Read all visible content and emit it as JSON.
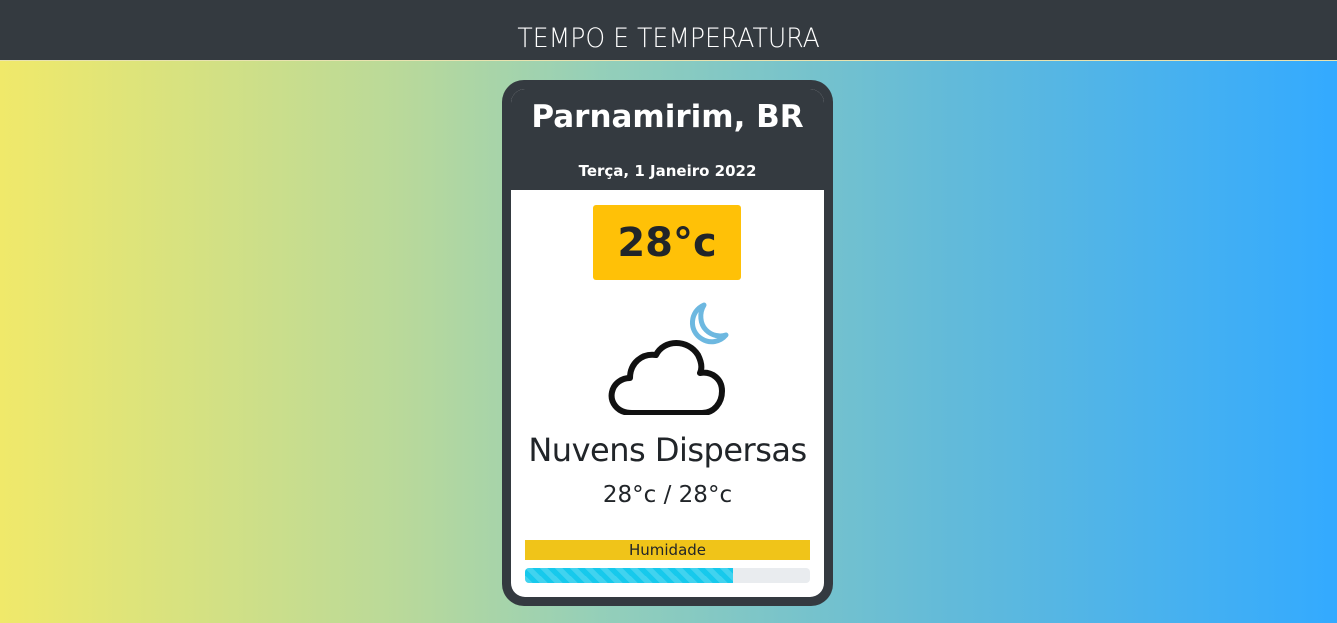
{
  "header": {
    "title": "TEMPO E TEMPERATURA"
  },
  "weather": {
    "location": "Parnamirim, BR",
    "date": "Terça, 1 Janeiro 2022",
    "temperature": "28°c",
    "icon": "cloud-moon-icon",
    "description": "Nuvens Dispersas",
    "min_max": "28°c / 28°c",
    "humidity_label": "Humidade",
    "humidity_percent": 73
  },
  "colors": {
    "dark": "#343a40",
    "temperature_badge": "#ffc107",
    "humidity_label_bg": "#f0c419",
    "humidity_bar": "#17c9ec",
    "moon": "#6db8e0"
  }
}
